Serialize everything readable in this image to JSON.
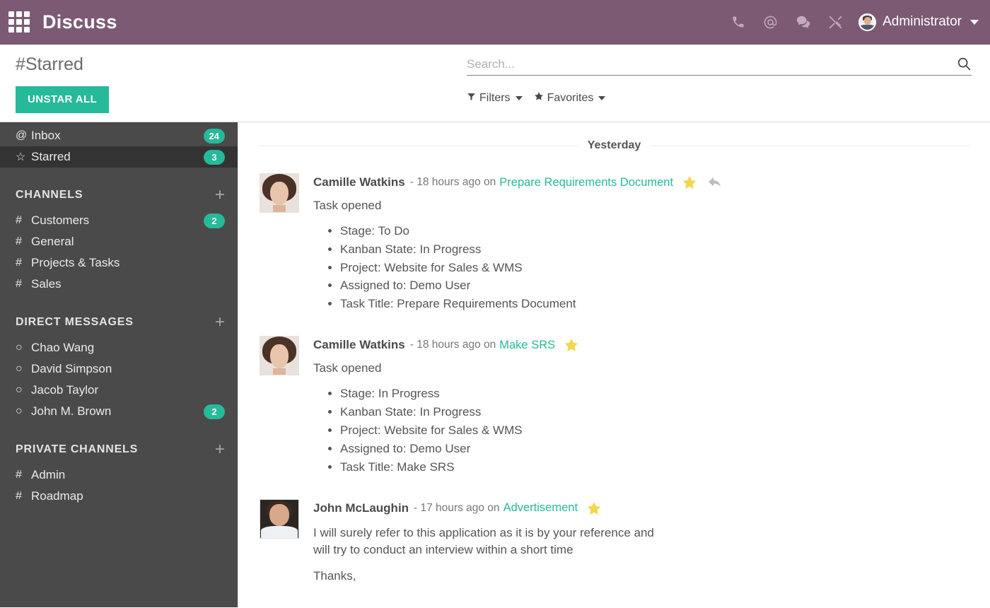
{
  "topbar": {
    "apps_icon": "apps-grid-icon",
    "app_title": "Discuss",
    "icons": [
      {
        "name": "phone-icon",
        "label": ""
      },
      {
        "name": "mention-at-icon",
        "label": ""
      },
      {
        "name": "chat-bubble-icon",
        "label": ""
      },
      {
        "name": "tools-wrench-icon",
        "label": ""
      }
    ],
    "user_name": "Administrator",
    "brand_color": "#7c5a74"
  },
  "controlpanel": {
    "title": "#Starred",
    "unstar_label": "UNSTAR ALL",
    "unstar_color": "#26b99a",
    "search_placeholder": "Search...",
    "search_value": "",
    "filters_label": "Filters",
    "favorites_label": "Favorites"
  },
  "sidebar": {
    "background": "#4a4a4a",
    "mailboxes": [
      {
        "glyph": "@",
        "label": "Inbox",
        "badge": "24",
        "active": false,
        "name": "sidebar-item-inbox"
      },
      {
        "glyph": "☆",
        "label": "Starred",
        "badge": "3",
        "active": true,
        "name": "sidebar-item-starred"
      }
    ],
    "sections": [
      {
        "title": "CHANNELS",
        "name": "sidebar-section-channels",
        "items": [
          {
            "glyph": "#",
            "label": "Customers",
            "badge": "2"
          },
          {
            "glyph": "#",
            "label": "General",
            "badge": ""
          },
          {
            "glyph": "#",
            "label": "Projects & Tasks",
            "badge": ""
          },
          {
            "glyph": "#",
            "label": "Sales",
            "badge": ""
          }
        ]
      },
      {
        "title": "DIRECT MESSAGES",
        "name": "sidebar-section-direct-messages",
        "items": [
          {
            "glyph": "○",
            "label": "Chao Wang",
            "badge": ""
          },
          {
            "glyph": "○",
            "label": "David Simpson",
            "badge": ""
          },
          {
            "glyph": "○",
            "label": "Jacob Taylor",
            "badge": ""
          },
          {
            "glyph": "○",
            "label": "John M. Brown",
            "badge": "2"
          }
        ]
      },
      {
        "title": "PRIVATE CHANNELS",
        "name": "sidebar-section-private-channels",
        "items": [
          {
            "glyph": "#",
            "label": "Admin",
            "badge": ""
          },
          {
            "glyph": "#",
            "label": "Roadmap",
            "badge": ""
          }
        ]
      }
    ]
  },
  "thread": {
    "day_separator": "Yesterday",
    "messages": [
      {
        "author": "Camille Watkins",
        "meta": "- 18 hours ago on",
        "document": "Prepare Requirements Document",
        "starred": true,
        "has_reply": true,
        "avatar": "woman",
        "text": "Task opened",
        "bullets": [
          "Stage: To Do",
          "Kanban State: In Progress",
          "Project: Website for Sales & WMS",
          "Assigned to: Demo User",
          "Task Title: Prepare Requirements Document"
        ],
        "paragraphs": []
      },
      {
        "author": "Camille Watkins",
        "meta": "- 18 hours ago on",
        "document": "Make SRS",
        "starred": true,
        "has_reply": false,
        "avatar": "woman",
        "text": "Task opened",
        "bullets": [
          "Stage: In Progress",
          "Kanban State: In Progress",
          "Project: Website for Sales & WMS",
          "Assigned to: Demo User",
          "Task Title: Make SRS"
        ],
        "paragraphs": []
      },
      {
        "author": "John McLaughin",
        "meta": "- 17 hours ago on",
        "document": "Advertisement",
        "starred": true,
        "has_reply": false,
        "avatar": "man",
        "text": "I will surely refer to this application as it is by your reference and will try to conduct an interview within a short time",
        "bullets": [],
        "paragraphs": [
          "Thanks,"
        ]
      }
    ],
    "star_color": "#f5d74e",
    "link_color": "#26b99a"
  }
}
